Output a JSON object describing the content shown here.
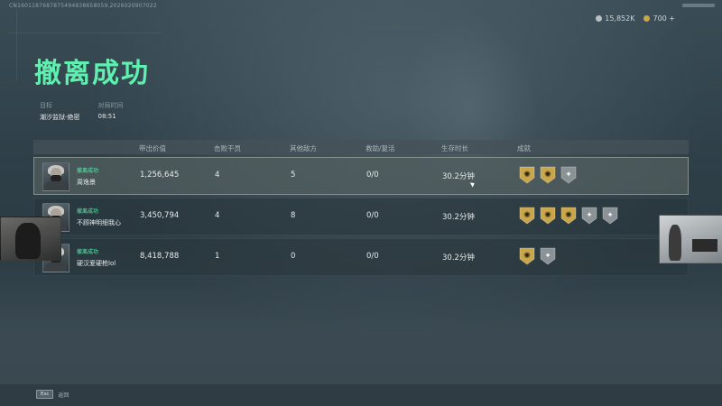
{
  "session_id": "CN1601187687875494838658059,2026020907022",
  "currency": [
    {
      "icon": "silver-coin-icon",
      "amount": "15,852K"
    },
    {
      "icon": "gold-coin-icon",
      "amount": "700 +"
    }
  ],
  "title": "撤离成功",
  "info": {
    "target_label": "目标",
    "target_value": "潮汐监狱-绝密",
    "time_label": "对局时间",
    "time_value": "08:51"
  },
  "table": {
    "headers": [
      "带出价值",
      "击败干员",
      "其他敌方",
      "救助/复活",
      "生存时长",
      "成就"
    ],
    "rows": [
      {
        "status": "撤离成功",
        "name": "周逸景",
        "value": "1,256,645",
        "kills": "4",
        "other": "5",
        "rescue": "0/0",
        "time": "30.2分钟",
        "badges": [
          "gold",
          "gold",
          "silver"
        ],
        "highlight": true
      },
      {
        "status": "撤离成功",
        "name": "不顾神明细我心",
        "value": "3,450,794",
        "kills": "4",
        "other": "8",
        "rescue": "0/0",
        "time": "30.2分钟",
        "badges": [
          "gold",
          "gold",
          "gold",
          "silver",
          "silver"
        ],
        "highlight": false
      },
      {
        "status": "撤离成功",
        "name": "硬汉爱硬枪lol",
        "value": "8,418,788",
        "kills": "1",
        "other": "0",
        "rescue": "0/0",
        "time": "30.2分钟",
        "badges": [
          "gold",
          "silver"
        ],
        "highlight": false
      }
    ]
  },
  "footer": {
    "key": "Esc",
    "label": "返回"
  },
  "colors": {
    "accent": "#5ff0b0",
    "gold_badge": "#c9a64a",
    "silver_badge": "#8a9296"
  }
}
